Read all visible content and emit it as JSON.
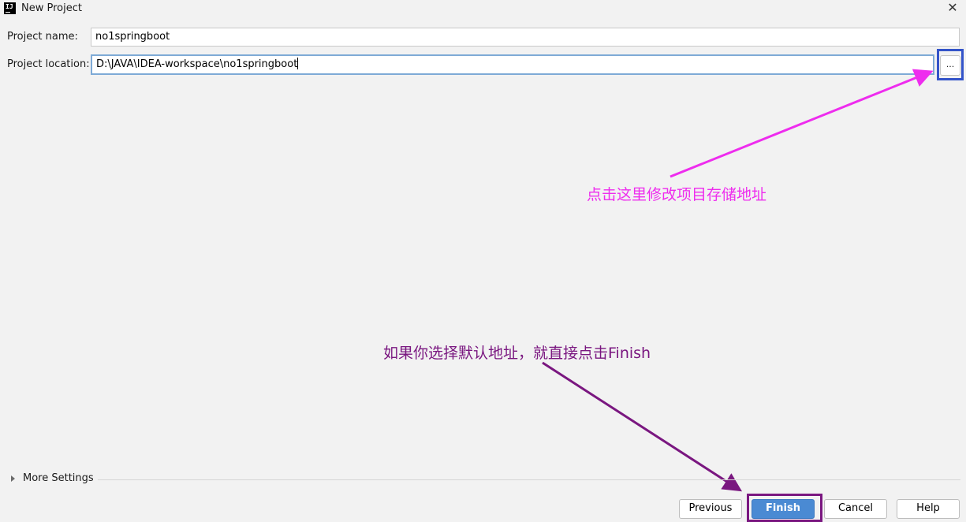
{
  "window": {
    "title": "New Project",
    "app_icon": "IJ"
  },
  "form": {
    "name_label": "Project name:",
    "name_value": "no1springboot",
    "location_label": "Project location:",
    "location_value": "D:\\JAVA\\IDEA-workspace\\no1springboot",
    "browse_label": "..."
  },
  "more_settings": {
    "label": "More Settings"
  },
  "buttons": {
    "previous": "Previous",
    "finish": "Finish",
    "cancel": "Cancel",
    "help": "Help"
  },
  "annotations": {
    "location_note": "点击这里修改项目存储地址",
    "finish_note": "如果你选择默认地址，就直接点击Finish"
  },
  "colors": {
    "annotation_pink": "#ee2cee",
    "annotation_purple": "#7a1780",
    "highlight_blue": "#3454c9",
    "finish_blue": "#4a8ad3"
  },
  "icons": {
    "close": "close-icon",
    "expand": "triangle-right-icon",
    "app": "intellij-icon"
  }
}
